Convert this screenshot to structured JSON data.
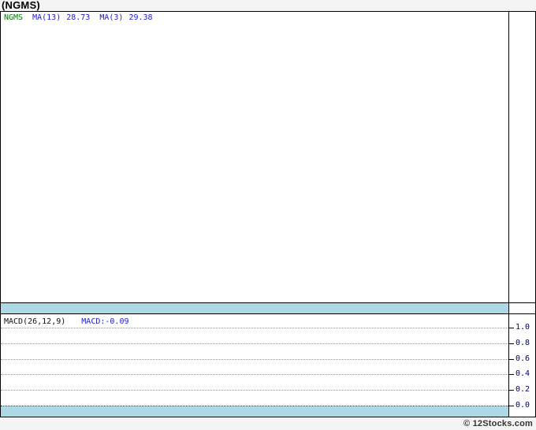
{
  "page": {
    "background": "#f4f4f5",
    "watermark": "© 12Stocks.com"
  },
  "title": "(NGMS)",
  "main_panel": {
    "legend": {
      "ticker": "NGMS",
      "ma13_label": "MA(13)",
      "ma13_value": "28.73",
      "ma3_label": "MA(3)",
      "ma3_value": "29.38"
    }
  },
  "macd_panel": {
    "label": "MACD(26,12,9)",
    "value_label": "MACD:-0.09",
    "axis_ticks": [
      "1.0",
      "0.8",
      "0.6",
      "0.4",
      "0.2",
      "0.0"
    ]
  },
  "colors": {
    "ticker_green": "#008000",
    "indicator_blue": "#2222cc",
    "band_blue": "#add8e6",
    "axis_text": "#000066",
    "border": "#000000",
    "gridline_gray": "#999999"
  },
  "chart_data": [
    {
      "type": "line",
      "title": "(NGMS)",
      "panel": "price",
      "legend_position": "top-left",
      "legend": [
        "NGMS",
        "MA(13) 28.73",
        "MA(3) 29.38"
      ],
      "indicators": [
        {
          "name": "MA(13)",
          "value": 28.73
        },
        {
          "name": "MA(3)",
          "value": 29.38
        }
      ],
      "series": [],
      "visible_data_points": 0,
      "grid": "off",
      "y_axis_labels": []
    },
    {
      "type": "line",
      "title": "MACD(26,12,9)",
      "panel": "macd",
      "legend_position": "top-left",
      "indicators": [
        {
          "name": "MACD",
          "value": -0.09
        }
      ],
      "series": [],
      "visible_data_points": 0,
      "grid": "dotted-horizontal",
      "ylim": [
        0.0,
        1.0
      ],
      "yticks": [
        1.0,
        0.8,
        0.6,
        0.4,
        0.2,
        0.0
      ],
      "y_axis_side": "right"
    }
  ]
}
